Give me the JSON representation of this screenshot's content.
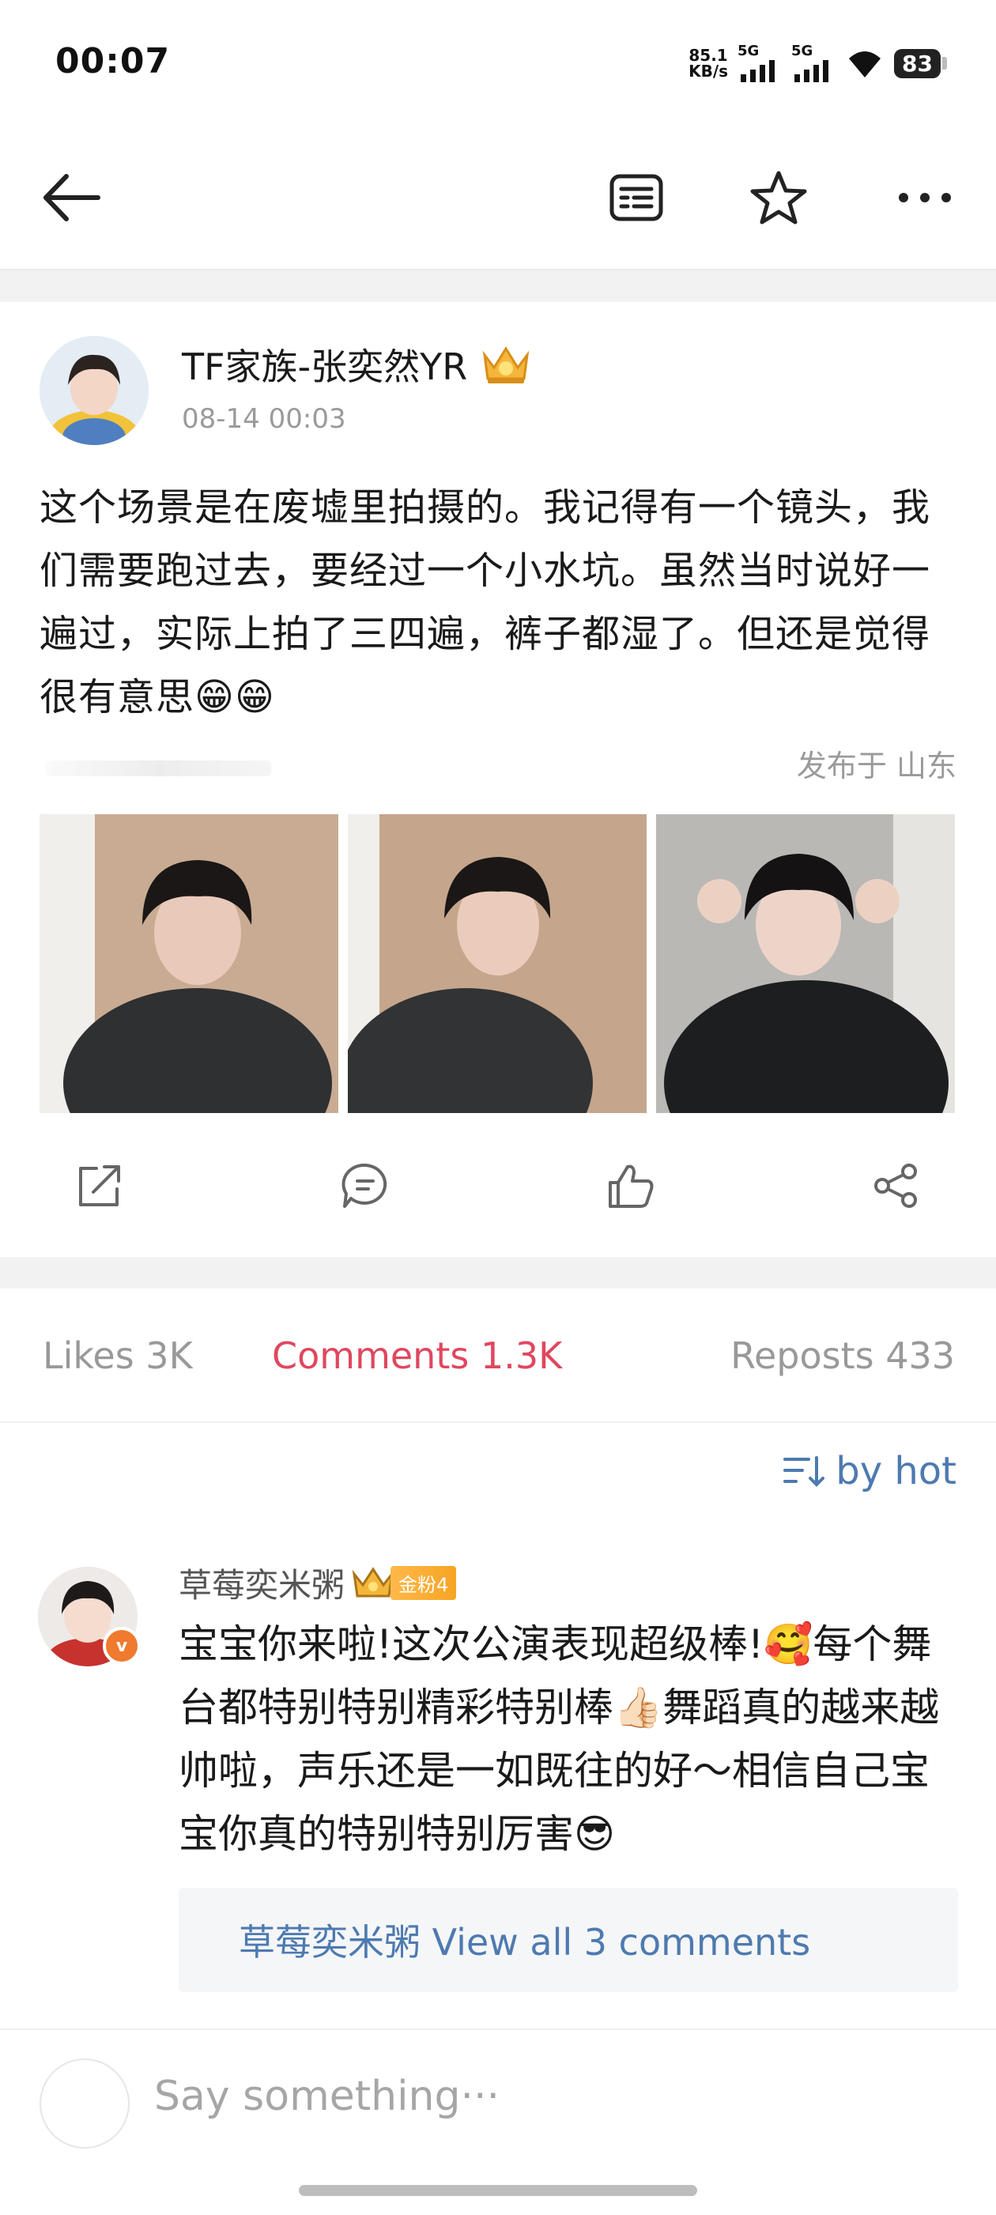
{
  "status": {
    "time": "00:07",
    "net_speed_value": "85.1",
    "net_speed_unit": "KB/s",
    "sim1": "5G",
    "sim2": "5G",
    "battery": "83"
  },
  "topbar": {
    "icons": [
      "back-arrow-icon",
      "reader-icon",
      "star-icon",
      "more-icon"
    ]
  },
  "post": {
    "author": "TF家族-张奕然YR",
    "timestamp": "08-14 00:03",
    "text": "这个场景是在废墟里拍摄的。我记得有一个镜头，我们需要跑过去，要经过一个小水坑。虽然当时说好一遍过，实际上拍了三四遍，裤子都湿了。但还是觉得很有意思😁😁",
    "location": "发布于 山东",
    "photo_count": 3
  },
  "tabs": {
    "likes": "Likes 3K",
    "comments": "Comments 1.3K",
    "reposts": "Reposts 433",
    "active": "comments"
  },
  "sort": {
    "label": "by hot"
  },
  "comment": {
    "username": "草莓奕米粥",
    "fan_level": "金粉4",
    "verified_badge": "v",
    "text": "宝宝你来啦!这次公演表现超级棒!🥰每个舞台都特别特别精彩特别棒👍🏻舞蹈真的越来越帅啦，声乐还是一如既往的好～相信自己宝宝你真的特别特别厉害😎",
    "replies_author": "草莓奕米粥",
    "replies_link": "View all 3 comments"
  },
  "compose": {
    "placeholder": "Say something···"
  },
  "colors": {
    "accent_red": "#e0475f",
    "link_blue": "#4d7ab0"
  }
}
